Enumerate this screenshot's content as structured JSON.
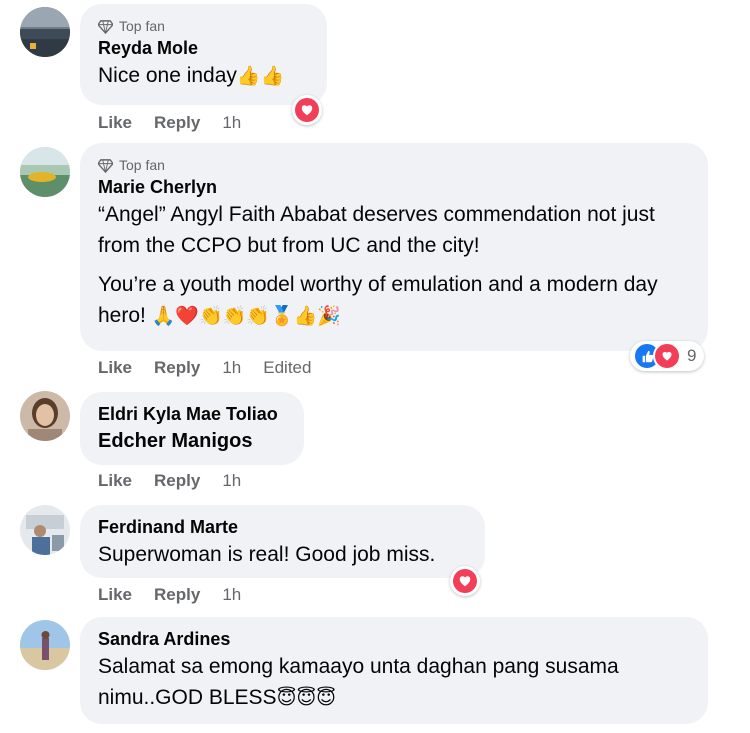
{
  "comments": [
    {
      "badge": "Top fan",
      "author": "Reyda Mole",
      "text": [
        "Nice one inday"
      ],
      "emoji": "👍👍",
      "actions": {
        "like": "Like",
        "reply": "Reply",
        "time": "1h"
      },
      "reaction": "heart"
    },
    {
      "badge": "Top fan",
      "author": "Marie Cherlyn",
      "text": [
        "“Angel” Angyl Faith Ababat deserves commendation not just from the CCPO but from UC and the city!",
        "You’re a youth model worthy of emulation and a modern day hero!"
      ],
      "emoji": "🙏❤️👏👏👏🏅👍🎉",
      "actions": {
        "like": "Like",
        "reply": "Reply",
        "time": "1h",
        "edited": "Edited"
      },
      "reaction_count": "9"
    },
    {
      "author": "Eldri Kyla Mae Toliao",
      "text": [
        "Edcher Manigos"
      ],
      "actions": {
        "like": "Like",
        "reply": "Reply",
        "time": "1h"
      }
    },
    {
      "author": "Ferdinand Marte",
      "text": [
        "Superwoman is real! Good job miss."
      ],
      "actions": {
        "like": "Like",
        "reply": "Reply",
        "time": "1h"
      },
      "reaction": "heart"
    },
    {
      "author": "Sandra Ardines",
      "text": [
        "Salamat sa emong kamaayo unta daghan pang susama nimu..GOD BLESS"
      ],
      "emoji": "😇😇😇"
    }
  ],
  "colors": {
    "bubble": "#f0f2f5",
    "secondary_text": "#65676b",
    "heart": "#f33e58",
    "like_blue": "#1877f2"
  }
}
